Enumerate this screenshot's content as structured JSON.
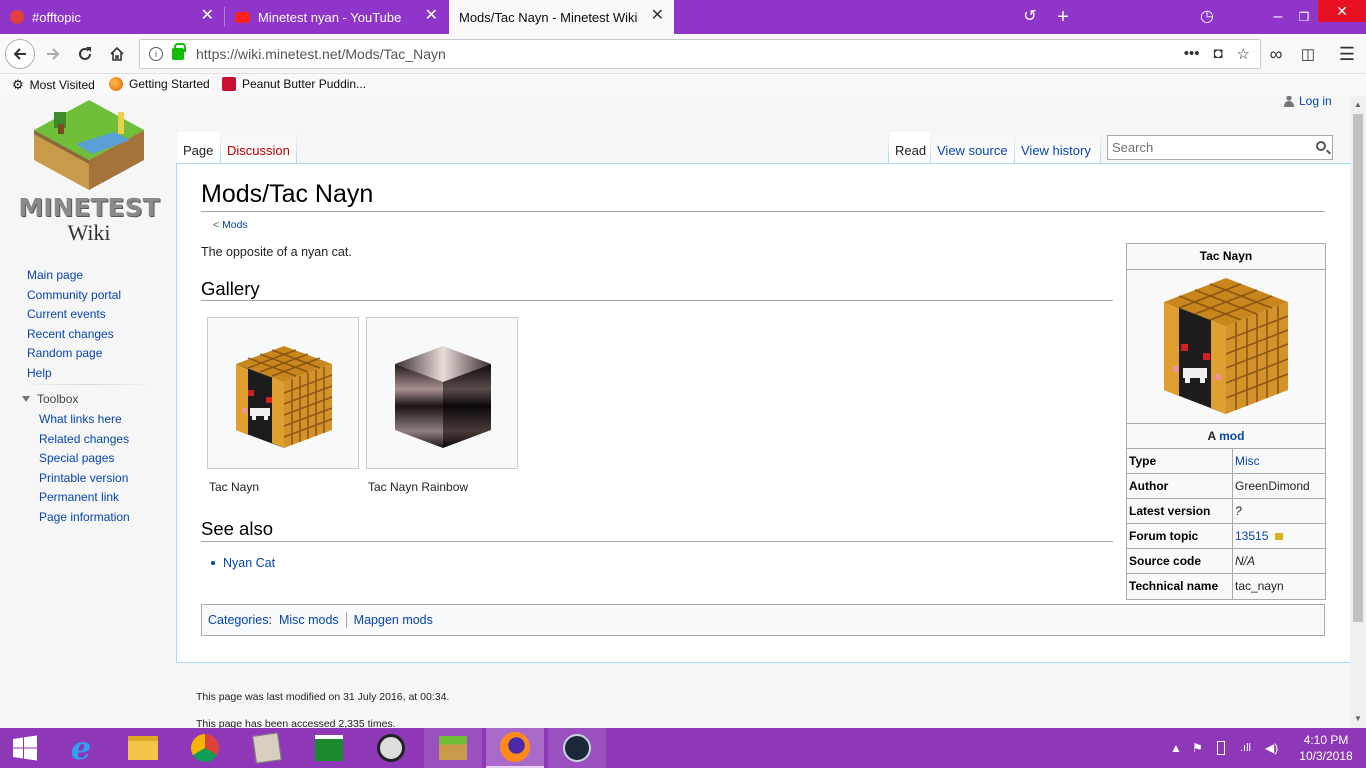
{
  "browser": {
    "tabs": [
      {
        "title": "#offtopic"
      },
      {
        "title": "Minetest nyan - YouTube"
      },
      {
        "title": "Mods/Tac Nayn - Minetest Wiki"
      }
    ],
    "url": "https://wiki.minetest.net/Mods/Tac_Nayn",
    "bookmarks": [
      "Most Visited",
      "Getting Started",
      "Peanut Butter Puddin..."
    ]
  },
  "wiki": {
    "logo_text": "MINETEST",
    "logo_sub": "Wiki",
    "login": "Log in",
    "nav": [
      "Main page",
      "Community portal",
      "Current events",
      "Recent changes",
      "Random page",
      "Help"
    ],
    "toolbox_title": "Toolbox",
    "toolbox": [
      "What links here",
      "Related changes",
      "Special pages",
      "Printable version",
      "Permanent link",
      "Page information"
    ],
    "tabs": {
      "page": "Page",
      "discussion": "Discussion",
      "read": "Read",
      "view_source": "View source",
      "view_history": "View history"
    },
    "search_placeholder": "Search"
  },
  "article": {
    "title": "Mods/Tac Nayn",
    "breadcrumb_prefix": "<",
    "breadcrumb_link": "Mods",
    "intro": "The opposite of a nyan cat.",
    "gallery_heading": "Gallery",
    "gallery": [
      {
        "caption": "Tac Nayn"
      },
      {
        "caption": "Tac Nayn Rainbow"
      }
    ],
    "see_also_heading": "See also",
    "see_also": [
      "Nyan Cat"
    ],
    "categories_label": "Categories",
    "categories": [
      "Misc mods",
      "Mapgen mods"
    ],
    "last_modified": "This page was last modified on 31 July 2016, at 00:34.",
    "accessed": "This page has been accessed 2,335 times."
  },
  "infobox": {
    "title": "Tac Nayn",
    "caption_prefix": "A",
    "caption_link": "mod",
    "rows": [
      {
        "key": "Type",
        "value": "Misc"
      },
      {
        "key": "Author",
        "value": "GreenDimond"
      },
      {
        "key": "Latest version",
        "value": "?"
      },
      {
        "key": "Forum topic",
        "value": "13515"
      },
      {
        "key": "Source code",
        "value": "N/A"
      },
      {
        "key": "Technical name",
        "value": "tac_nayn"
      }
    ]
  },
  "taskbar": {
    "time": "4:10 PM",
    "date": "10/3/2018"
  },
  "colors": {
    "tabbar": "#8f35c9",
    "taskbar": "#8e38b8",
    "link": "#0645ad",
    "redlink": "#ba0000"
  }
}
